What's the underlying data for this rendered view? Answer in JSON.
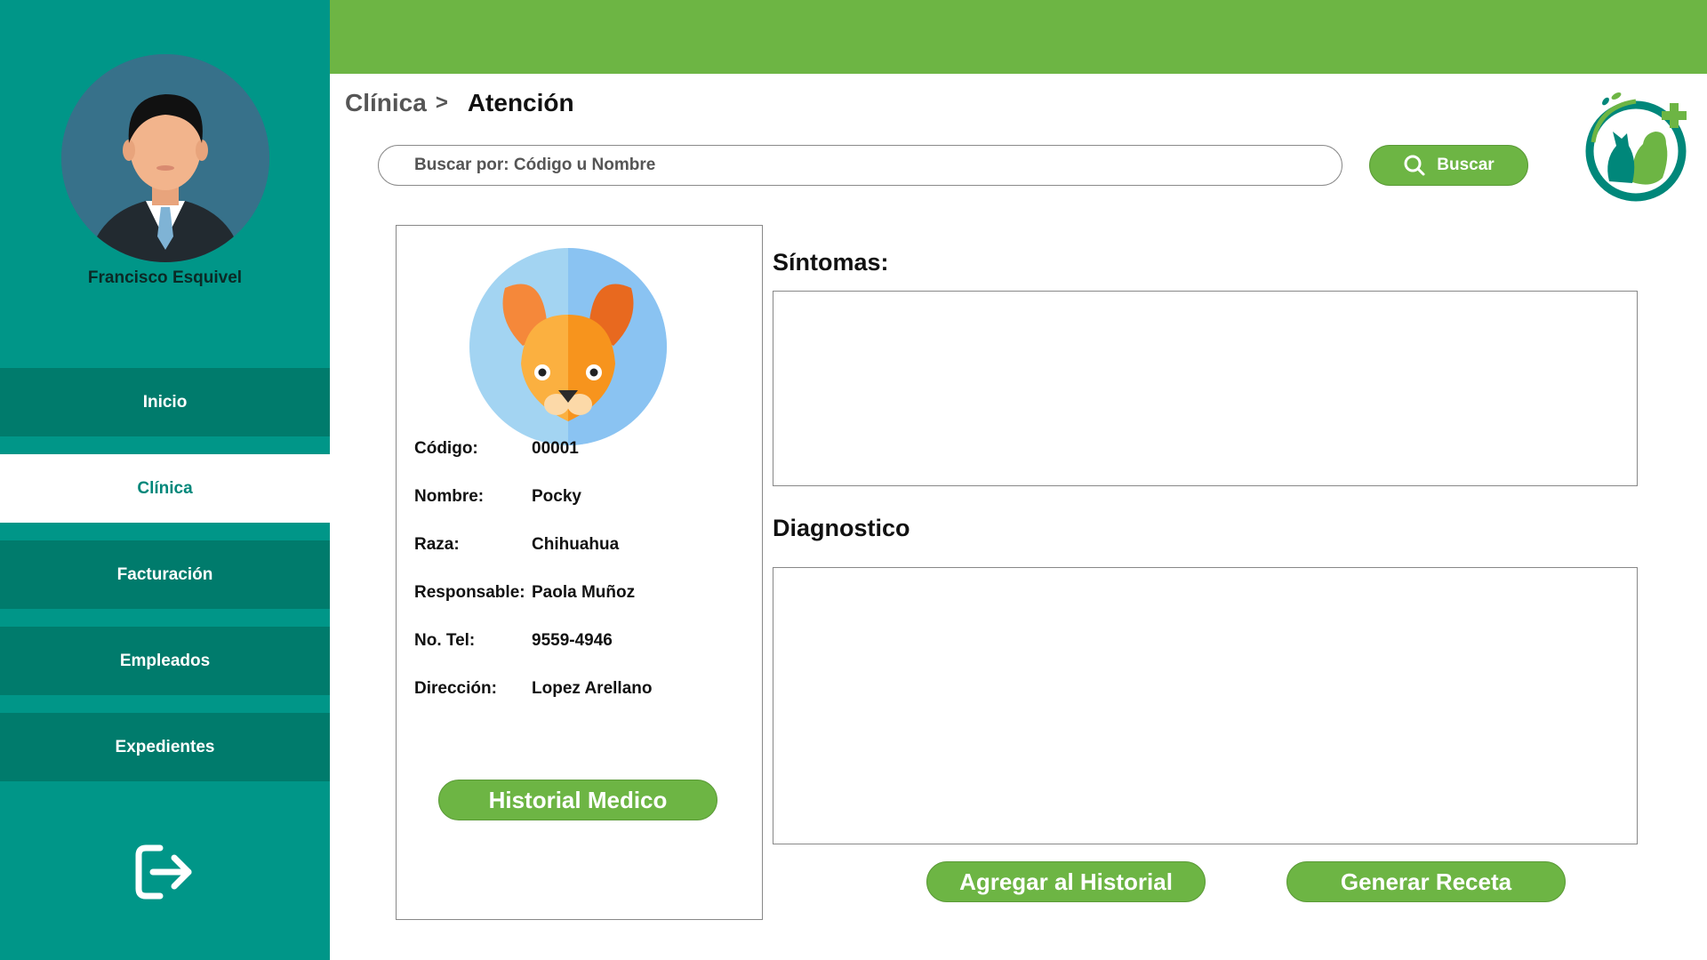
{
  "user": {
    "name": "Francisco Esquivel"
  },
  "nav": {
    "items": [
      {
        "label": "Inicio"
      },
      {
        "label": "Clínica"
      },
      {
        "label": "Facturación"
      },
      {
        "label": "Empleados"
      },
      {
        "label": "Expedientes"
      }
    ],
    "active": "Clínica",
    "logout_icon": "logout-icon"
  },
  "breadcrumb": {
    "root": "Clínica",
    "separator": ">",
    "current": "Atención"
  },
  "search": {
    "placeholder": "Buscar por: Código u Nombre",
    "value": "",
    "button_label": "Buscar",
    "icon": "search-icon"
  },
  "pet": {
    "fields": [
      {
        "label": "Código:",
        "value": "00001"
      },
      {
        "label": "Nombre:",
        "value": "Pocky"
      },
      {
        "label": "Raza:",
        "value": "Chihuahua"
      },
      {
        "label": "Responsable:",
        "value": "Paola Muñoz"
      },
      {
        "label": "No. Tel:",
        "value": "9559-4946"
      },
      {
        "label": "Dirección:",
        "value": "Lopez Arellano"
      }
    ],
    "history_button": "Historial Medico"
  },
  "symptoms": {
    "title": "Síntomas:",
    "value": ""
  },
  "diagnosis": {
    "title": "Diagnostico",
    "value": ""
  },
  "actions": {
    "add_history": "Agregar al Historial",
    "prescription": "Generar Receta"
  },
  "colors": {
    "sidebar": "#009688",
    "nav_item": "#007b6c",
    "topbar": "#6db544",
    "button": "#6db544"
  }
}
